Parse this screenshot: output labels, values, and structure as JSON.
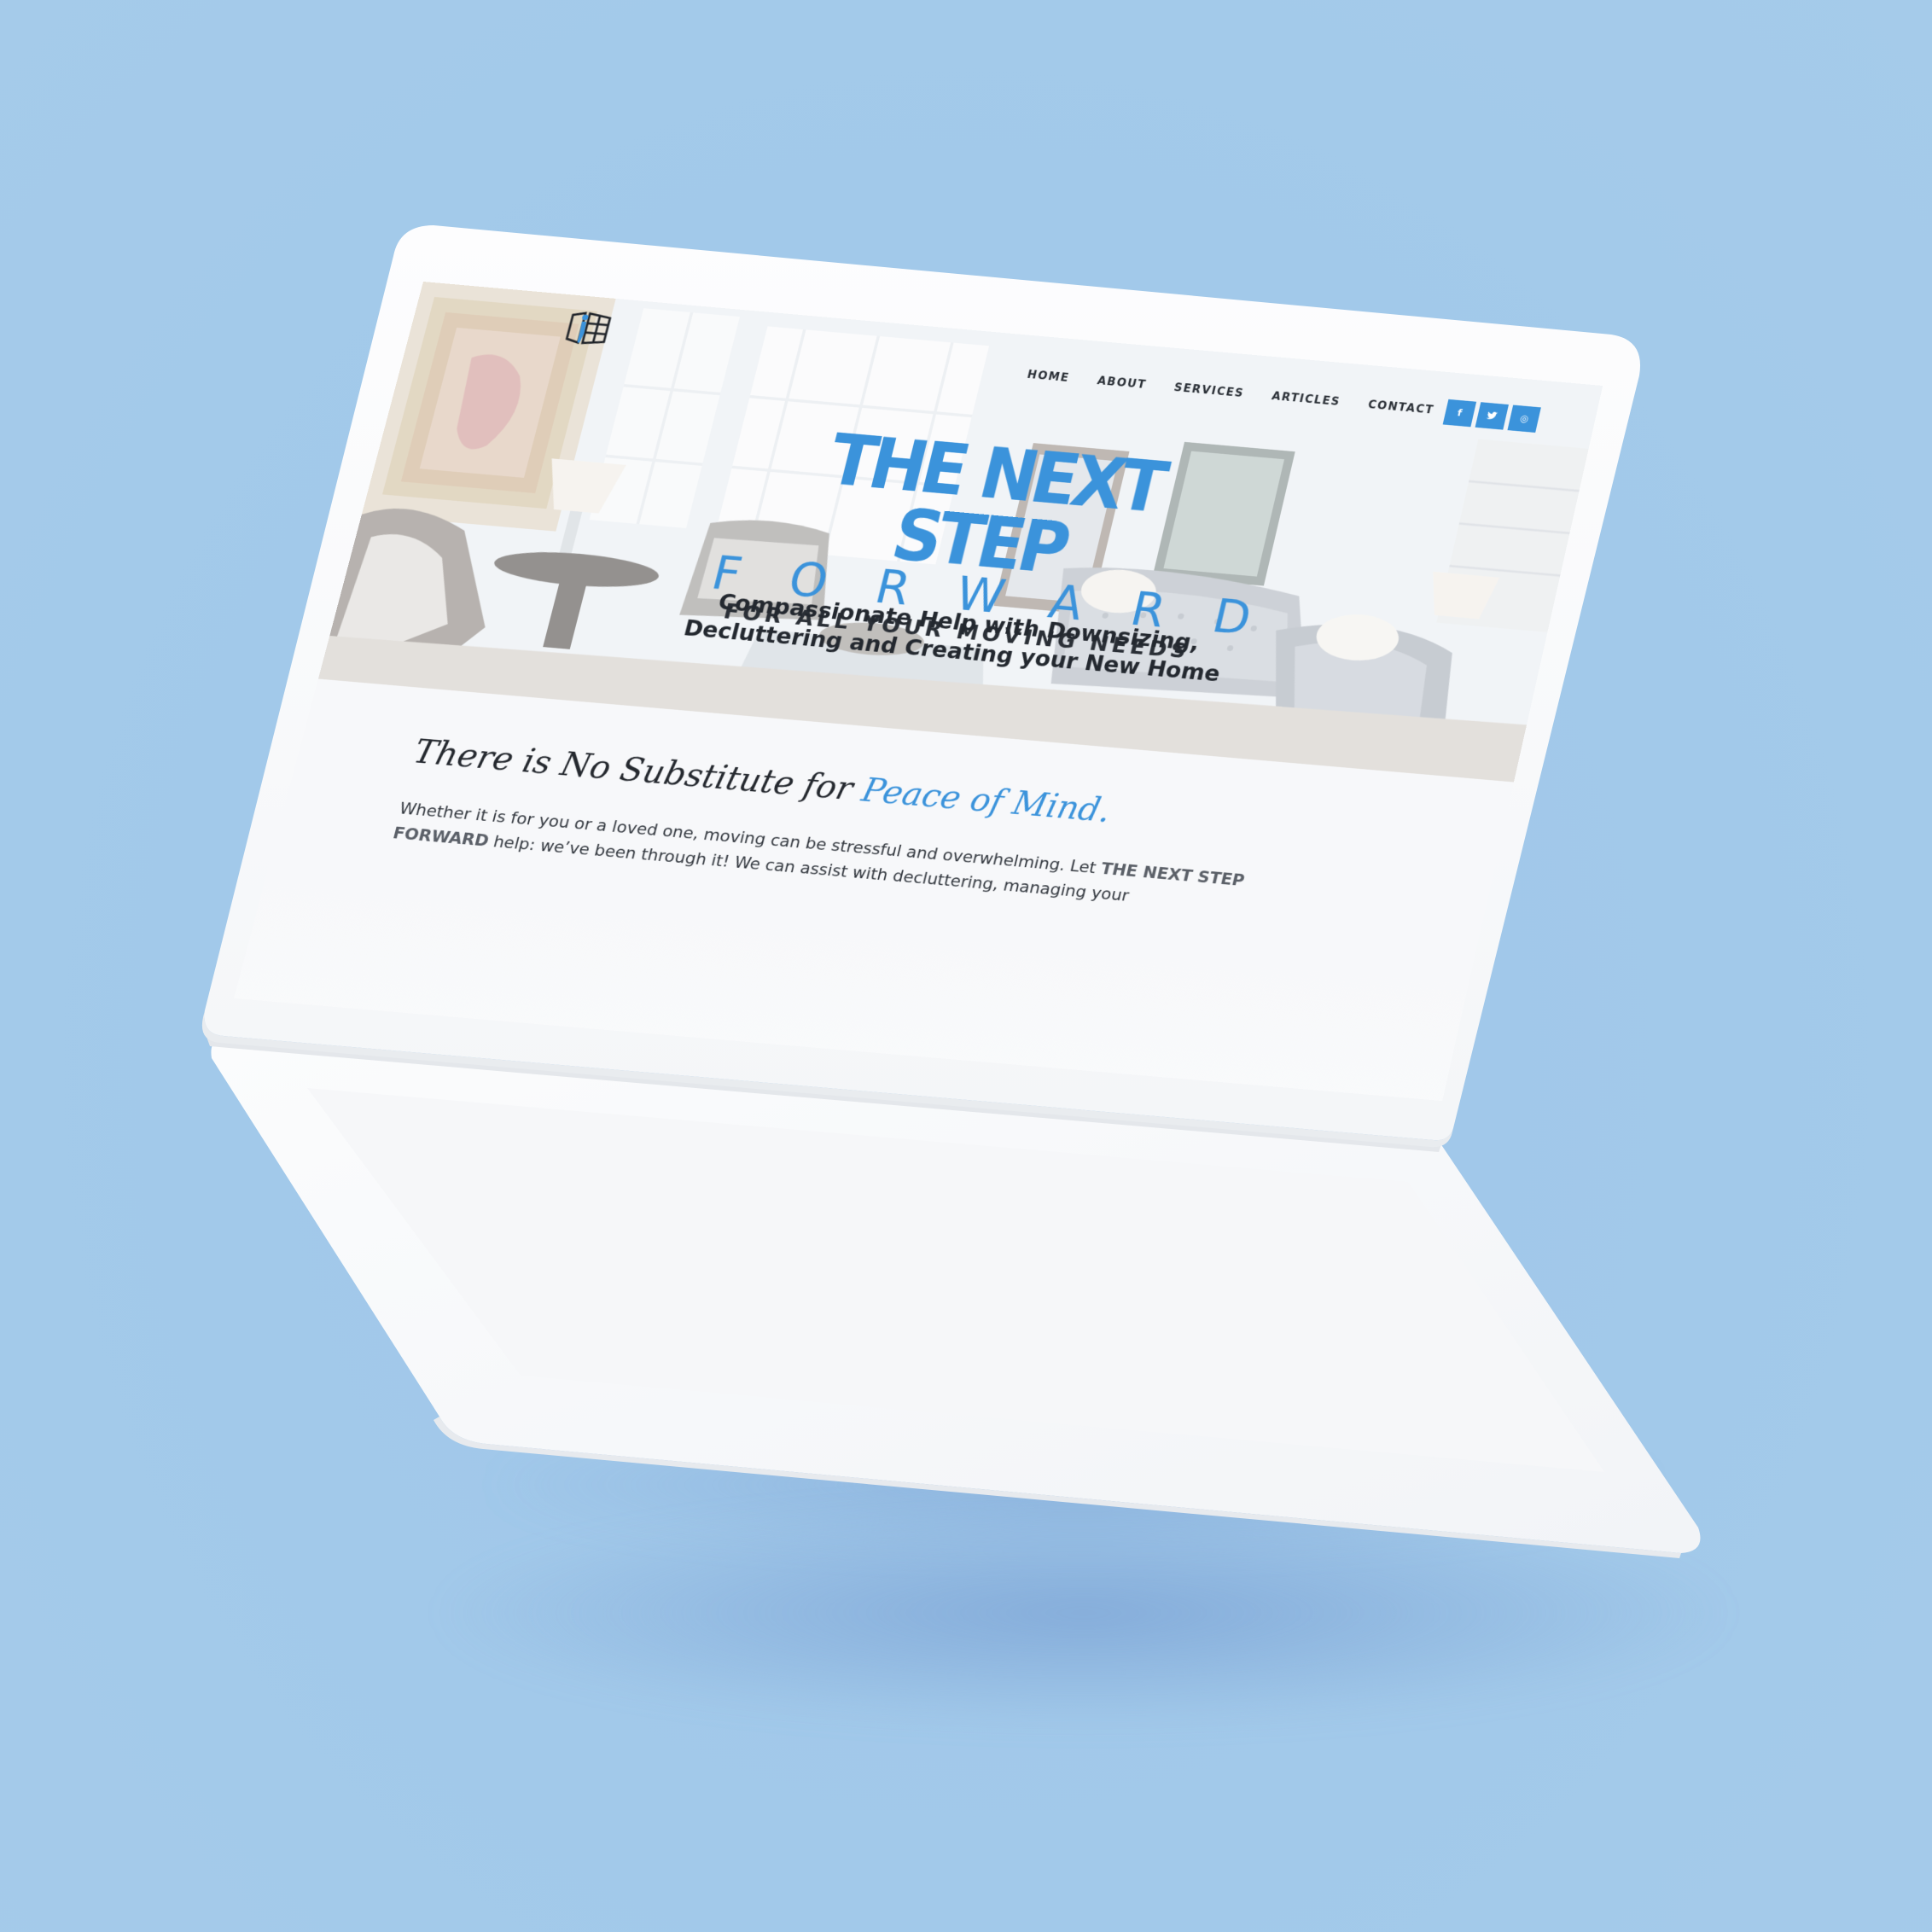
{
  "site": {
    "nav": {
      "items": [
        "HOME",
        "ABOUT",
        "SERVICES",
        "ARTICLES",
        "CONTACT"
      ]
    },
    "social": {
      "facebook": "f",
      "twitter": "t",
      "instagram": "◎"
    },
    "brand": {
      "line1": "THE NEXT STEP",
      "line2": "FORWARD",
      "line3": "FOR ALL YOUR MOVING NEEDS"
    },
    "tagline": {
      "line1": "Compassionate Help with Downsizing,",
      "line2": "Decluttering and Creating your New Home"
    },
    "headline": {
      "prefix": "There is No Substitute for",
      "accent": "Peace of Mind."
    },
    "body": {
      "part1": "Whether it is for you or a loved one, moving can be stressful and overwhelming. Let ",
      "strong": "THE NEXT STEP FORWARD",
      "part2": " help: we’ve been through it! We can assist with decluttering, managing your"
    }
  },
  "colors": {
    "background": "#a3caea",
    "accent": "#3b93db",
    "device": "#f8f9fb",
    "text_dark": "#25292f"
  },
  "icons": [
    "logo-window-icon",
    "facebook-icon",
    "twitter-icon",
    "instagram-icon"
  ]
}
